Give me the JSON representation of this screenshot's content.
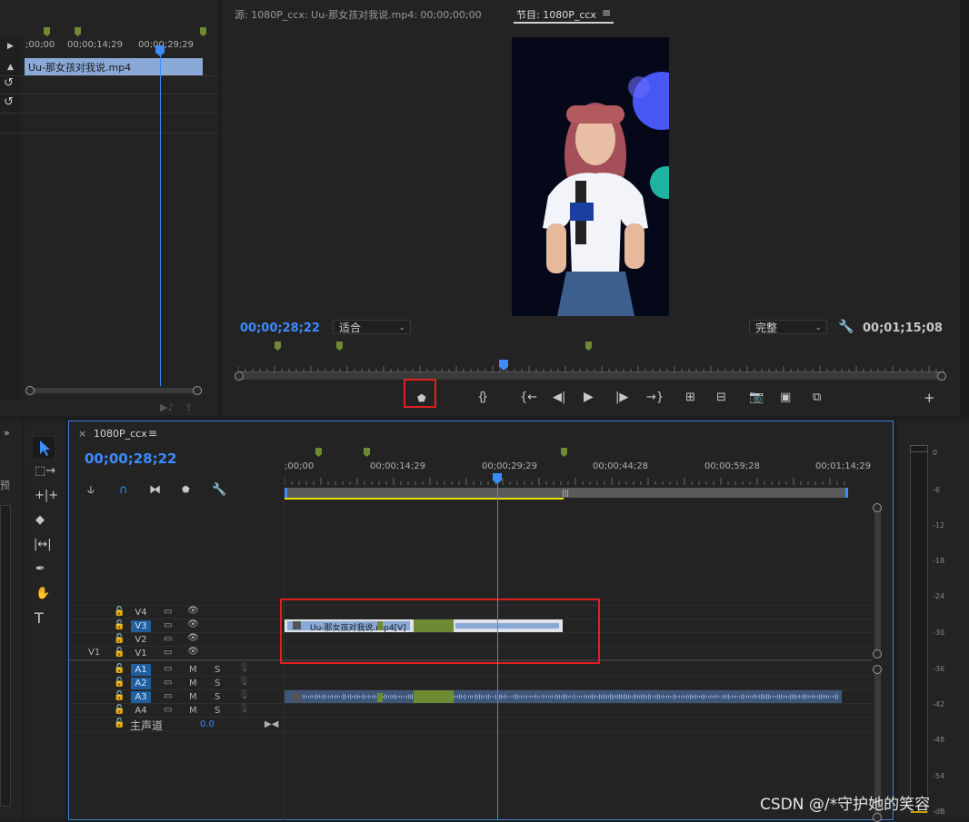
{
  "source_panel": {
    "timecodes": [
      ";00;00",
      "00;00;14;29",
      "00;00;29;29"
    ],
    "clip_name": "Uu-那女孩对我说.mp4"
  },
  "program_monitor": {
    "source_tab": "源: 1080P_ccx: Uu-那女孩对我说.mp4: 00;00;00;00",
    "program_tab": "节目: 1080P_ccx",
    "menu_icon": "hamburger-icon",
    "current_time": "00;00;28;22",
    "fit_select": "适合",
    "quality_select": "完整",
    "duration": "00;01;15;08",
    "buttons": [
      "add-marker",
      "mark-in",
      "mark-out",
      "go-to-in",
      "step-back",
      "play",
      "step-forward",
      "go-to-out",
      "lift",
      "extract",
      "export-frame",
      "insert",
      "overwrite"
    ]
  },
  "timeline": {
    "tab_label": "1080P_ccx",
    "close_label": "×",
    "current_time": "00;00;28;22",
    "ruler_labels": [
      ";00;00",
      "00;00;14;29",
      "00;00;29;29",
      "00;00;44;28",
      "00;00;59;28",
      "00;01;14;29"
    ],
    "video_tracks": [
      {
        "name": "V4",
        "source": "",
        "selected": false
      },
      {
        "name": "V3",
        "source": "",
        "selected": true
      },
      {
        "name": "V2",
        "source": "",
        "selected": false
      },
      {
        "name": "V1",
        "source": "V1",
        "selected": false
      }
    ],
    "audio_tracks": [
      {
        "name": "A1",
        "m": "M",
        "s": "S",
        "selected": true
      },
      {
        "name": "A2",
        "m": "M",
        "s": "S",
        "selected": true
      },
      {
        "name": "A3",
        "m": "M",
        "s": "S",
        "selected": true
      },
      {
        "name": "A4",
        "m": "M",
        "s": "S",
        "selected": false
      }
    ],
    "master_label": "主声道",
    "master_value": "0.0",
    "video_clip_label": "Uu-那女孩对我说.mp4",
    "video_clip_suffix": "[V]"
  },
  "left_panel": {
    "partial_label": "预"
  },
  "audio_meter": {
    "labels": [
      "0",
      "-6",
      "-12",
      "-18",
      "-24",
      "-30",
      "-36",
      "-42",
      "-48",
      "-54",
      "-dB"
    ]
  },
  "watermark": "CSDN @/*守护她的笑容",
  "colors": {
    "accent": "#3d8bff",
    "marker": "#6e8a32",
    "highlight_box": "#e02020",
    "clip_blue": "#8aa9d6"
  }
}
